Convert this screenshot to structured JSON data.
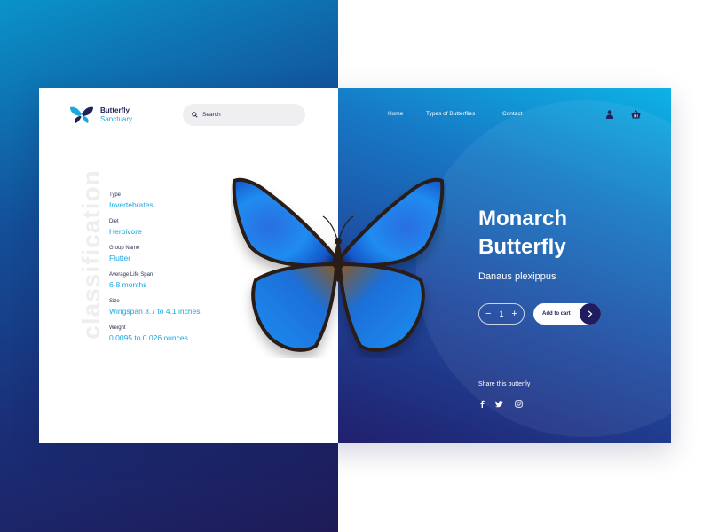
{
  "brand": {
    "name_line1": "Butterfly",
    "name_line2": "Sanctuary",
    "logo_icon": "butterfly-logo-icon"
  },
  "search": {
    "label": "Search",
    "icon": "search-icon"
  },
  "nav": {
    "items": [
      "Home",
      "Types of Butterflies",
      "Contact"
    ]
  },
  "header_icons": {
    "user": "user-icon",
    "cart": "basket-icon"
  },
  "classification": {
    "heading": "classification",
    "items": [
      {
        "label": "Type",
        "value": "Invertebrates"
      },
      {
        "label": "Diet",
        "value": "Herbivore"
      },
      {
        "label": "Group Name",
        "value": "Flutter"
      },
      {
        "label": "Average Life Span",
        "value": "6-8 months"
      },
      {
        "label": "Size",
        "value": "Wingspan 3.7 to 4.1 inches"
      },
      {
        "label": "Weight",
        "value": "0.0095 to 0.026 ounces"
      }
    ]
  },
  "product": {
    "title_line1": "Monarch",
    "title_line2": "Butterfly",
    "scientific_name": "Danaus plexippus",
    "quantity": "1",
    "minus": "−",
    "plus": "+",
    "add_to_cart": "Add to cart"
  },
  "share": {
    "label": "Share this butterfly",
    "icons": [
      "facebook-icon",
      "twitter-icon",
      "instagram-icon"
    ]
  },
  "colors": {
    "accent": "#1aa7e0",
    "navy": "#1f2157",
    "gradient_start": "#0db3e6",
    "gradient_end": "#211f6c"
  }
}
